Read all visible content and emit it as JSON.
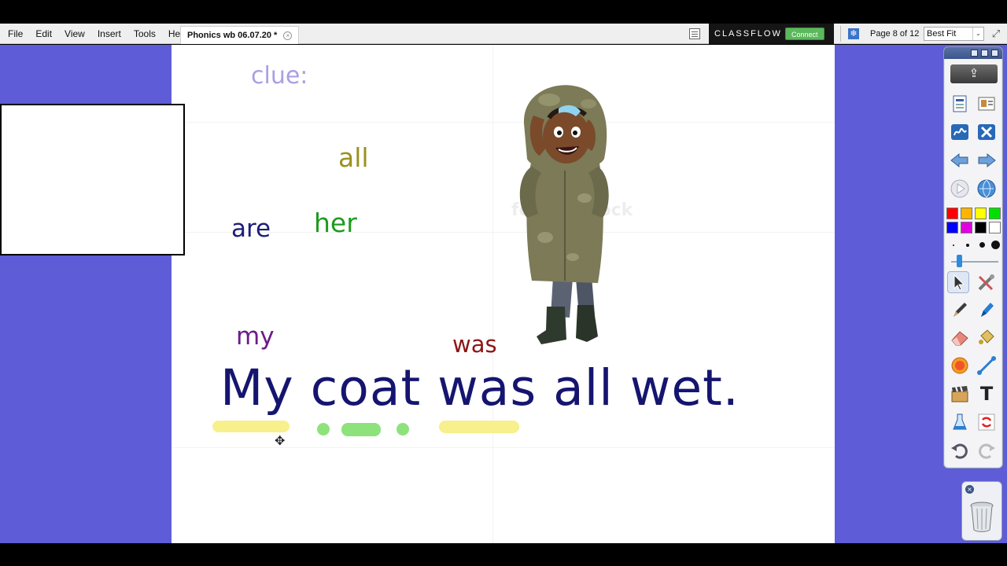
{
  "menu": {
    "items": [
      {
        "label": "File"
      },
      {
        "label": "Edit"
      },
      {
        "label": "View"
      },
      {
        "label": "Insert"
      },
      {
        "label": "Tools"
      },
      {
        "label": "Help"
      }
    ]
  },
  "document_tab": {
    "title": "Phonics wb 06.07.20 *",
    "close_glyph": "×"
  },
  "classflow": {
    "brand": "CLASSFLOW",
    "connect_label": "Connect"
  },
  "page_indicator": "Page 8 of 12",
  "zoom": {
    "selected": "Best Fit",
    "arrow": "⌄"
  },
  "flipchart": {
    "clue_label": "clue:",
    "word_cards": [
      "all",
      "are",
      "her",
      "my",
      "was"
    ],
    "sentence": "My coat was all wet.",
    "watermark": "fotolia stock",
    "colors": {
      "clue": "#a9a0e3",
      "all": "#9b9020",
      "are": "#1d1d7a",
      "her": "#1e9b1e",
      "my": "#6b1c8a",
      "was": "#8e1414",
      "sentence": "#151570",
      "highlight_yellow": "#f7f08c",
      "highlight_green": "#8ee27c"
    }
  },
  "toolbox": {
    "export_glyph": "⇪",
    "colors": [
      "#ff0000",
      "#ffb400",
      "#ffff00",
      "#00e000",
      "#0000ff",
      "#e000e0",
      "#000000",
      "#ffffff"
    ],
    "tools": [
      "page-browser-icon",
      "resource-browser-icon",
      "handwriting-icon",
      "tools-icon",
      "previous-page-icon",
      "next-page-icon",
      "play-icon",
      "globe-icon",
      "select-icon",
      "settings-icon",
      "pen-icon",
      "highlighter-icon",
      "eraser-icon",
      "fill-icon",
      "shape-icon",
      "connector-icon",
      "clapperboard-icon",
      "text-icon",
      "reveal-icon",
      "reset-page-icon",
      "undo-icon",
      "redo-icon"
    ]
  }
}
